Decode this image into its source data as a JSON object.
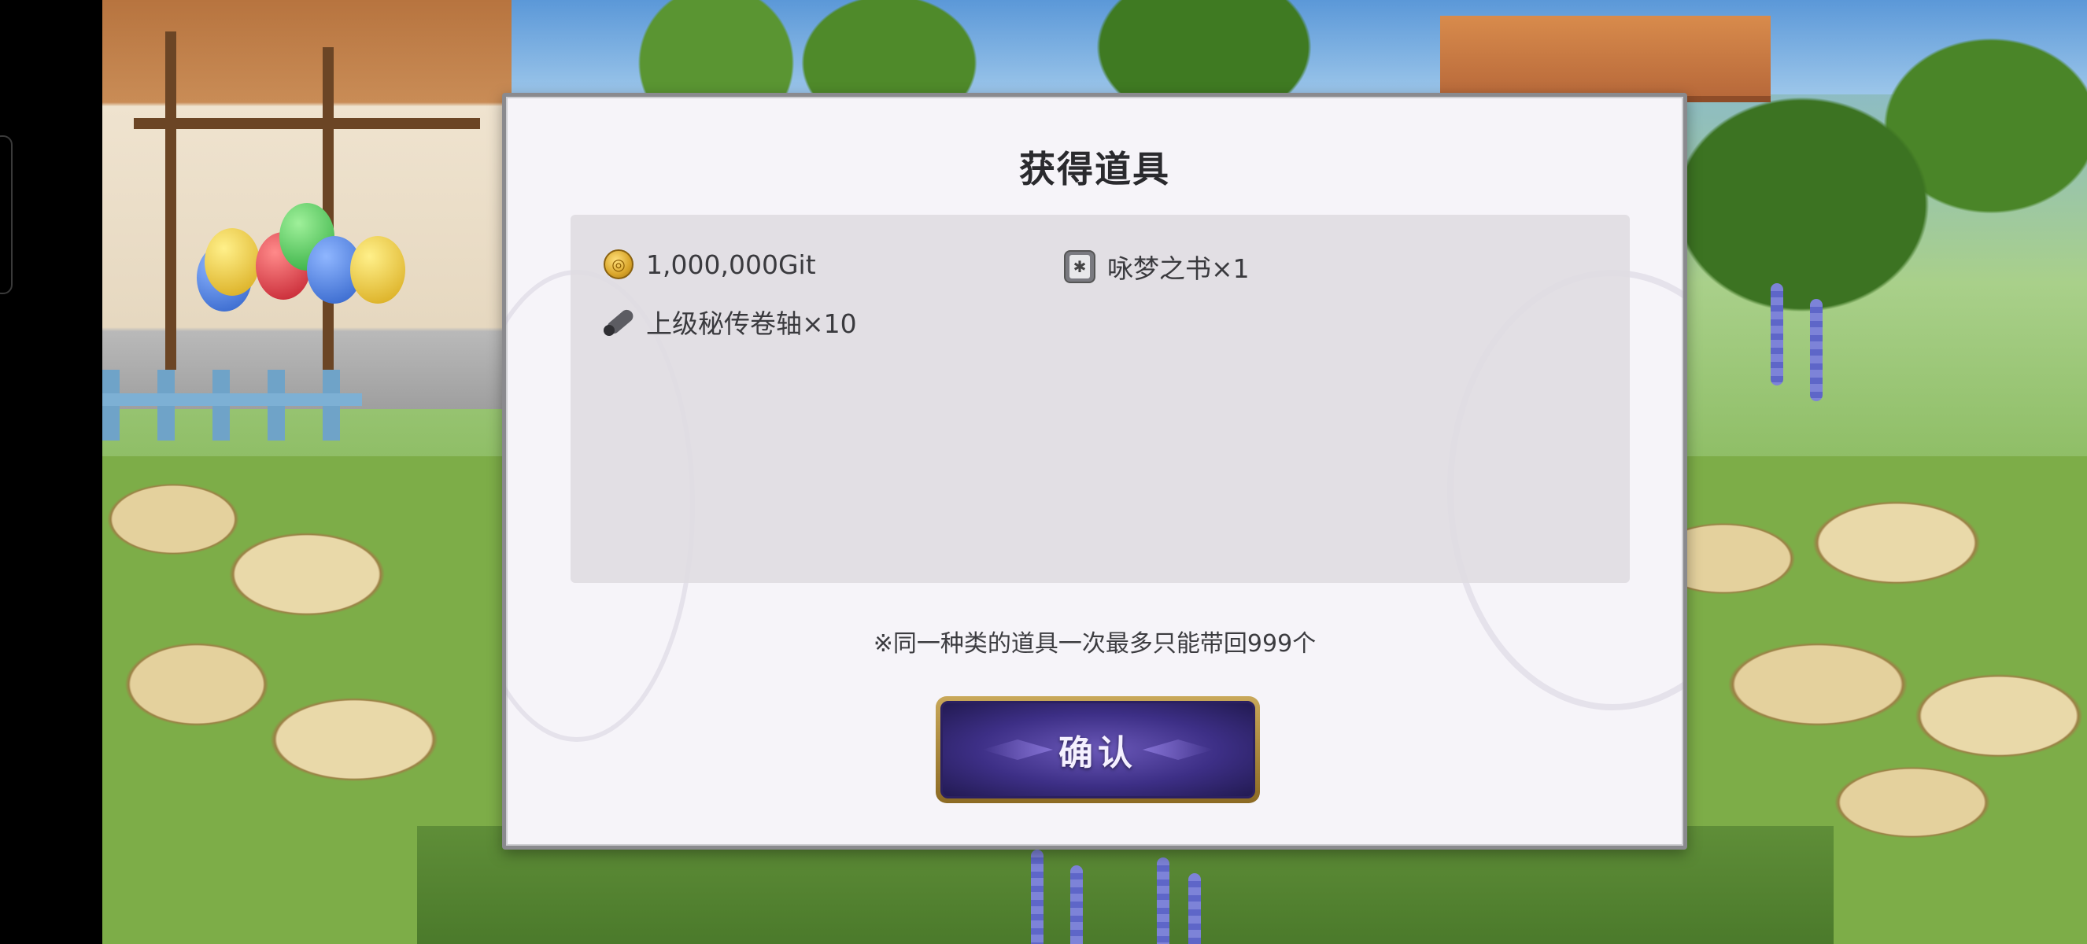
{
  "dialog": {
    "title": "获得道具",
    "items": [
      {
        "icon": "gold-coin-icon",
        "label": "1,000,000Git"
      },
      {
        "icon": "book-icon",
        "label": "咏梦之书×1"
      },
      {
        "icon": "scroll-icon",
        "label": "上级秘传卷轴×10"
      }
    ],
    "notice": "※同一种类的道具一次最多只能带回999个",
    "confirm_label": "确认"
  },
  "colors": {
    "modal_background": "#f6f4f9",
    "items_panel": "#e0dce2",
    "button_purple": "#3d2f86",
    "button_gold": "#c9a85a"
  }
}
